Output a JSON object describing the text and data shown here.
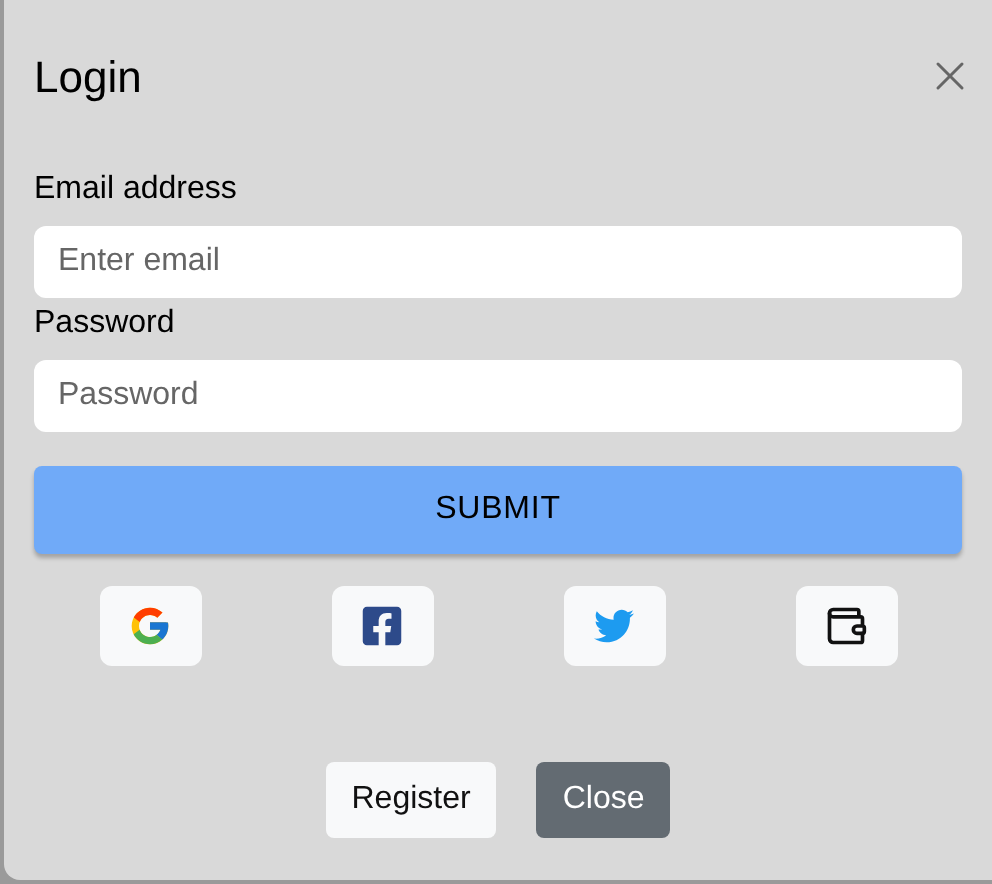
{
  "dialog": {
    "title": "Login"
  },
  "fields": [
    {
      "label": "Email address",
      "placeholder": "Enter email"
    },
    {
      "label": "Password",
      "placeholder": "Password"
    }
  ],
  "submit": "SUBMIT",
  "social": [
    {
      "kind": "google"
    },
    {
      "kind": "facebook"
    },
    {
      "kind": "twitter"
    },
    {
      "kind": "wallet"
    }
  ],
  "footer_buttons": [
    {
      "label": "Register",
      "kind": "light"
    },
    {
      "label": "Close",
      "kind": "secondary"
    }
  ]
}
